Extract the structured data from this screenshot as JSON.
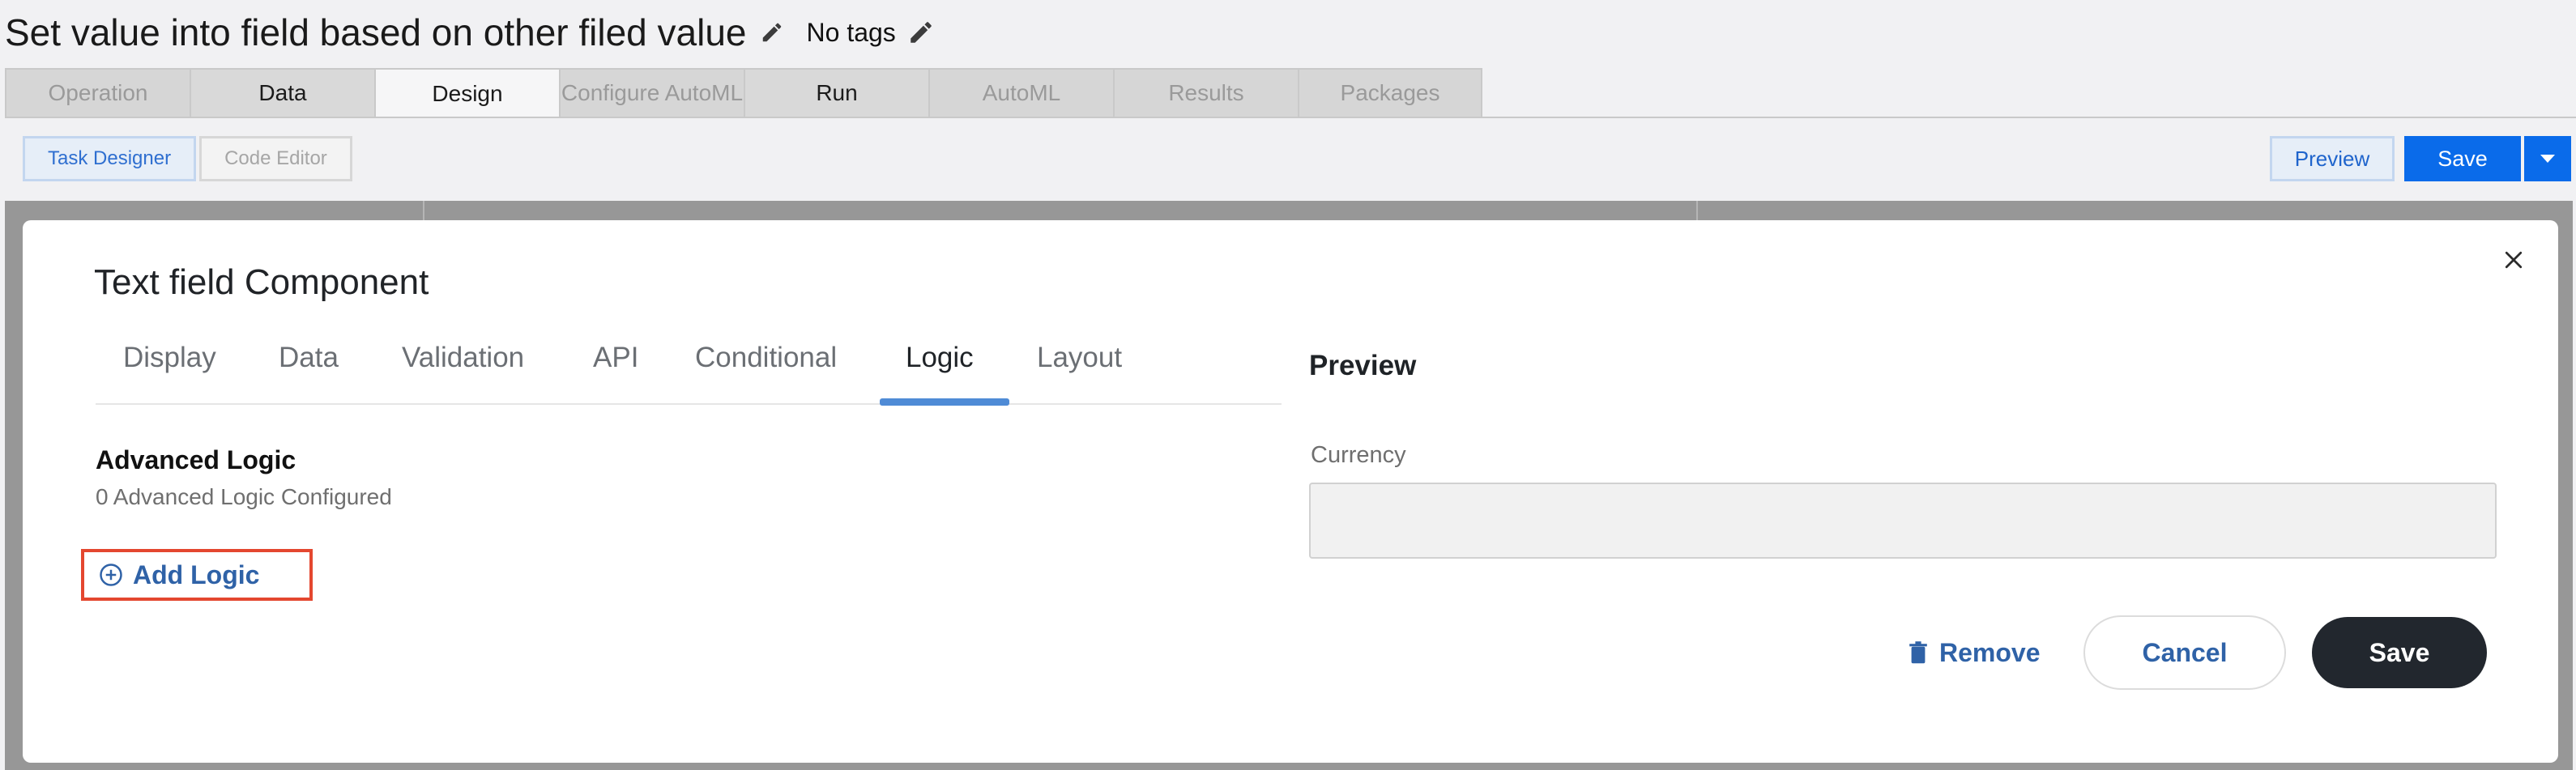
{
  "header": {
    "title": "Set value into field based on other filed value",
    "tags_label": "No tags"
  },
  "tabs": [
    {
      "label": "Operation",
      "state": "disabled"
    },
    {
      "label": "Data",
      "state": "enabled"
    },
    {
      "label": "Design",
      "state": "active"
    },
    {
      "label": "Configure AutoML",
      "state": "disabled"
    },
    {
      "label": "Run",
      "state": "enabled"
    },
    {
      "label": "AutoML",
      "state": "disabled"
    },
    {
      "label": "Results",
      "state": "disabled"
    },
    {
      "label": "Packages",
      "state": "disabled"
    }
  ],
  "toolbar": {
    "task_designer": "Task Designer",
    "code_editor": "Code Editor",
    "preview": "Preview",
    "save": "Save"
  },
  "modal": {
    "title": "Text field Component",
    "tabs": [
      "Display",
      "Data",
      "Validation",
      "API",
      "Conditional",
      "Logic",
      "Layout"
    ],
    "active_tab": "Logic",
    "advanced_logic_title": "Advanced Logic",
    "advanced_logic_count": "0 Advanced Logic Configured",
    "add_logic": "Add Logic",
    "preview_title": "Preview",
    "preview_field_label": "Currency",
    "preview_field_value": "",
    "remove": "Remove",
    "cancel": "Cancel",
    "save": "Save"
  },
  "colors": {
    "primary": "#0a6bea",
    "link": "#2f62a7",
    "highlight": "#e4472f",
    "dark_button": "#22272e"
  }
}
